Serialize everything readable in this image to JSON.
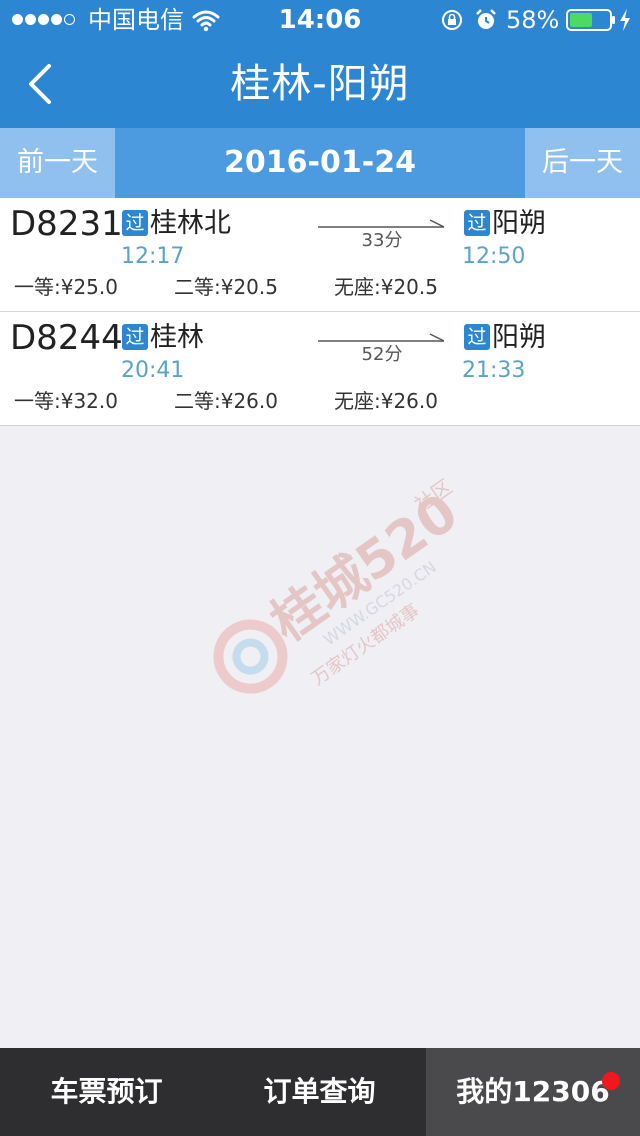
{
  "status_bar": {
    "carrier": "中国电信",
    "time": "14:06",
    "battery_percent": "58%",
    "battery_level": 0.58,
    "signal_bars_filled": 4,
    "signal_bars_total": 5
  },
  "nav": {
    "title": "桂林-阳朔",
    "back_icon": "chevron-left-icon"
  },
  "date_bar": {
    "prev_label": "前一天",
    "date": "2016-01-24",
    "next_label": "后一天"
  },
  "trains": [
    {
      "train_no": "D8231",
      "from_badge": "过",
      "from_station": "桂林北",
      "dep_time": "12:17",
      "duration": "33分",
      "to_badge": "过",
      "to_station": "阳朔",
      "arr_time": "12:50",
      "seats": [
        "一等:¥25.0",
        "二等:¥20.5",
        "无座:¥20.5"
      ]
    },
    {
      "train_no": "D8244",
      "from_badge": "过",
      "from_station": "桂林",
      "dep_time": "20:41",
      "duration": "52分",
      "to_badge": "过",
      "to_station": "阳朔",
      "arr_time": "21:33",
      "seats": [
        "一等:¥32.0",
        "二等:¥26.0",
        "无座:¥26.0"
      ]
    }
  ],
  "watermark": {
    "big_text": "桂城520",
    "side_text": "社区",
    "url": "WWW.GC520.CN",
    "slogan": "万家灯火都城事"
  },
  "tab_bar": {
    "tabs": [
      {
        "label": "车票预订",
        "active": false
      },
      {
        "label": "订单查询",
        "active": false
      },
      {
        "label": "我的12306",
        "active": true,
        "has_notification": true
      }
    ]
  },
  "colors": {
    "nav_blue": "#2d86d2",
    "date_bar_blue": "#4c9ae0",
    "date_button_blue": "#8fc0ee",
    "time_blue": "#5aa2c8",
    "tab_bar_dark": "#2e2e30",
    "notification_red": "#f2161d",
    "battery_green": "#4cd964"
  }
}
